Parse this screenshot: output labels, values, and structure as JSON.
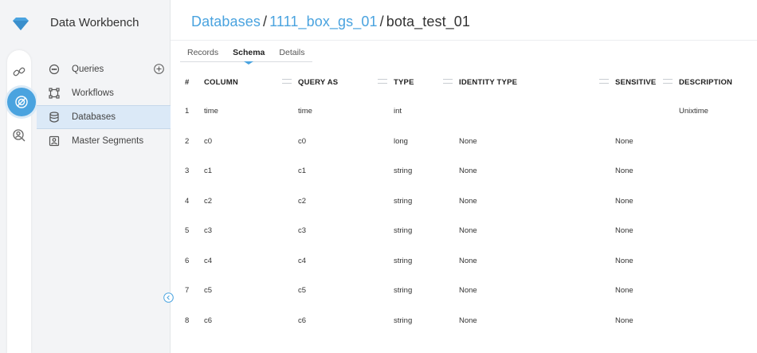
{
  "app": {
    "title": "Data Workbench"
  },
  "nav": {
    "items": [
      {
        "label": "Queries",
        "icon": "chat-icon"
      },
      {
        "label": "Workflows",
        "icon": "workflow-icon"
      },
      {
        "label": "Databases",
        "icon": "database-icon",
        "active": true
      },
      {
        "label": "Master Segments",
        "icon": "segment-icon"
      }
    ]
  },
  "breadcrumb": {
    "root": "Databases",
    "database": "1111_box_gs_01",
    "table": "bota_test_01",
    "separator": "/"
  },
  "tabs": [
    {
      "label": "Records"
    },
    {
      "label": "Schema",
      "active": true
    },
    {
      "label": "Details"
    }
  ],
  "schema": {
    "headers": {
      "num": "#",
      "column": "COLUMN",
      "query_as": "QUERY AS",
      "type": "TYPE",
      "identity_type": "IDENTITY TYPE",
      "sensitive": "SENSITIVE",
      "description": "DESCRIPTION"
    },
    "rows": [
      {
        "num": "1",
        "column": "time",
        "query_as": "time",
        "type": "int",
        "identity_type": "",
        "sensitive": "",
        "description": "Unixtime"
      },
      {
        "num": "2",
        "column": "c0",
        "query_as": "c0",
        "type": "long",
        "identity_type": "None",
        "sensitive": "None",
        "description": ""
      },
      {
        "num": "3",
        "column": "c1",
        "query_as": "c1",
        "type": "string",
        "identity_type": "None",
        "sensitive": "None",
        "description": ""
      },
      {
        "num": "4",
        "column": "c2",
        "query_as": "c2",
        "type": "string",
        "identity_type": "None",
        "sensitive": "None",
        "description": ""
      },
      {
        "num": "5",
        "column": "c3",
        "query_as": "c3",
        "type": "string",
        "identity_type": "None",
        "sensitive": "None",
        "description": ""
      },
      {
        "num": "6",
        "column": "c4",
        "query_as": "c4",
        "type": "string",
        "identity_type": "None",
        "sensitive": "None",
        "description": ""
      },
      {
        "num": "7",
        "column": "c5",
        "query_as": "c5",
        "type": "string",
        "identity_type": "None",
        "sensitive": "None",
        "description": ""
      },
      {
        "num": "8",
        "column": "c6",
        "query_as": "c6",
        "type": "string",
        "identity_type": "None",
        "sensitive": "None",
        "description": ""
      }
    ]
  },
  "colors": {
    "accent": "#4aa3df",
    "active_nav_bg": "#dbe9f7",
    "panel_bg": "#f3f4f6"
  }
}
